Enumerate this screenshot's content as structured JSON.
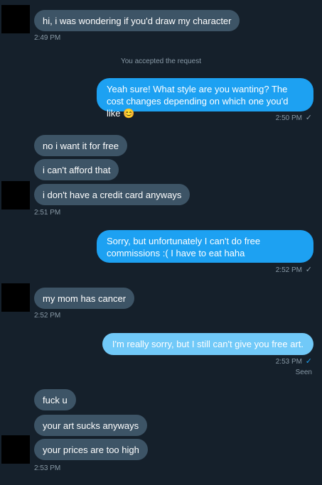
{
  "messages": {
    "m1": {
      "text": "hi, i was wondering if you'd draw my character",
      "time": "2:49 PM"
    },
    "system_note": "You accepted the request",
    "m2": {
      "text": "Yeah sure! What style are you wanting? The cost changes depending on which one you'd like",
      "emoji": "😊",
      "time": "2:50 PM",
      "check": "✓"
    },
    "m3": {
      "text": "no i want it for free"
    },
    "m4": {
      "text": "i can't afford that"
    },
    "m5": {
      "text": "i don't have a credit card anyways",
      "time": "2:51 PM"
    },
    "m6": {
      "text": "Sorry, but unfortunately I can't do free commissions :( I have to eat haha",
      "time": "2:52 PM",
      "check": "✓"
    },
    "m7": {
      "text": "my mom has cancer",
      "time": "2:52 PM"
    },
    "m8": {
      "text": "I'm really sorry, but I still can't give you free art.",
      "time": "2:53 PM",
      "check": "✓",
      "status": "Seen"
    },
    "m9": {
      "text": "fuck u"
    },
    "m10": {
      "text": "your art sucks anyways"
    },
    "m11": {
      "text": "your prices are too high",
      "time": "2:53 PM"
    }
  },
  "colors": {
    "background": "#15202b",
    "incoming_bubble": "#3d5466",
    "outgoing_bubble": "#1da1f2",
    "sending_bubble": "#71c9f8",
    "meta_text": "#8899a6"
  }
}
